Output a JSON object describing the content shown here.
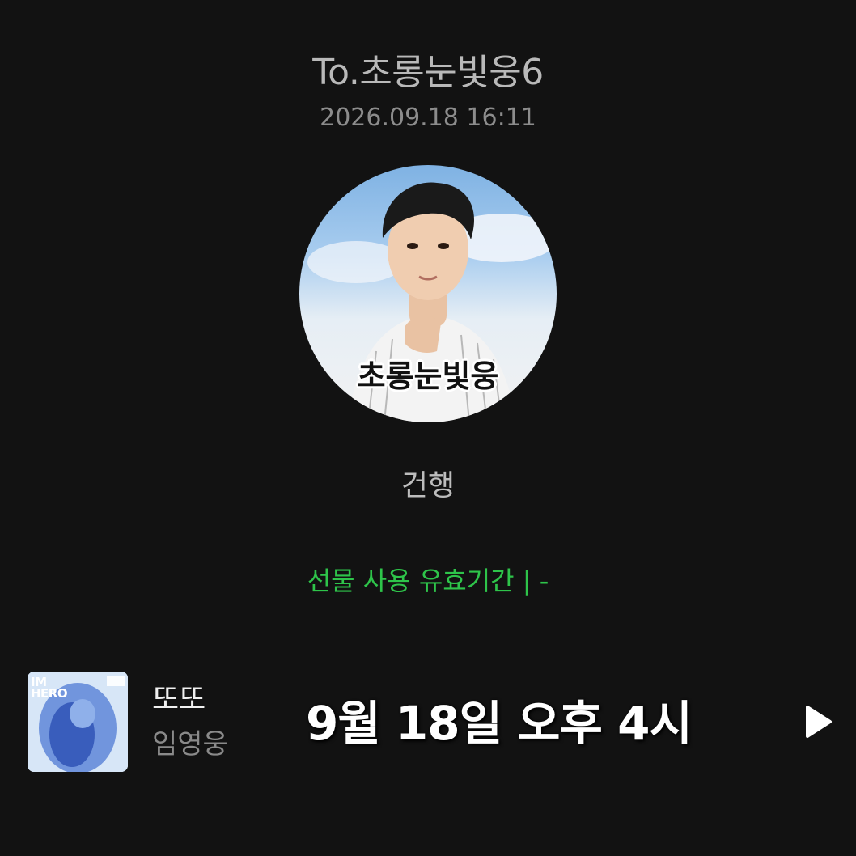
{
  "header": {
    "recipient": "To.초롱눈빛웅6",
    "timestamp": "2026.09.18 16:11"
  },
  "profile": {
    "caption": "초롱눈빛웅"
  },
  "gift": {
    "name": "건행",
    "validity": "선물 사용 유효기간 |   -"
  },
  "music": {
    "album_art_text": "IM\nHERO",
    "title": "또또",
    "artist": "임영웅",
    "overlay": "9월 18일 오후 4시",
    "play_icon": "play-icon"
  },
  "colors": {
    "background": "#121212",
    "accent_green": "#2ec44a"
  }
}
